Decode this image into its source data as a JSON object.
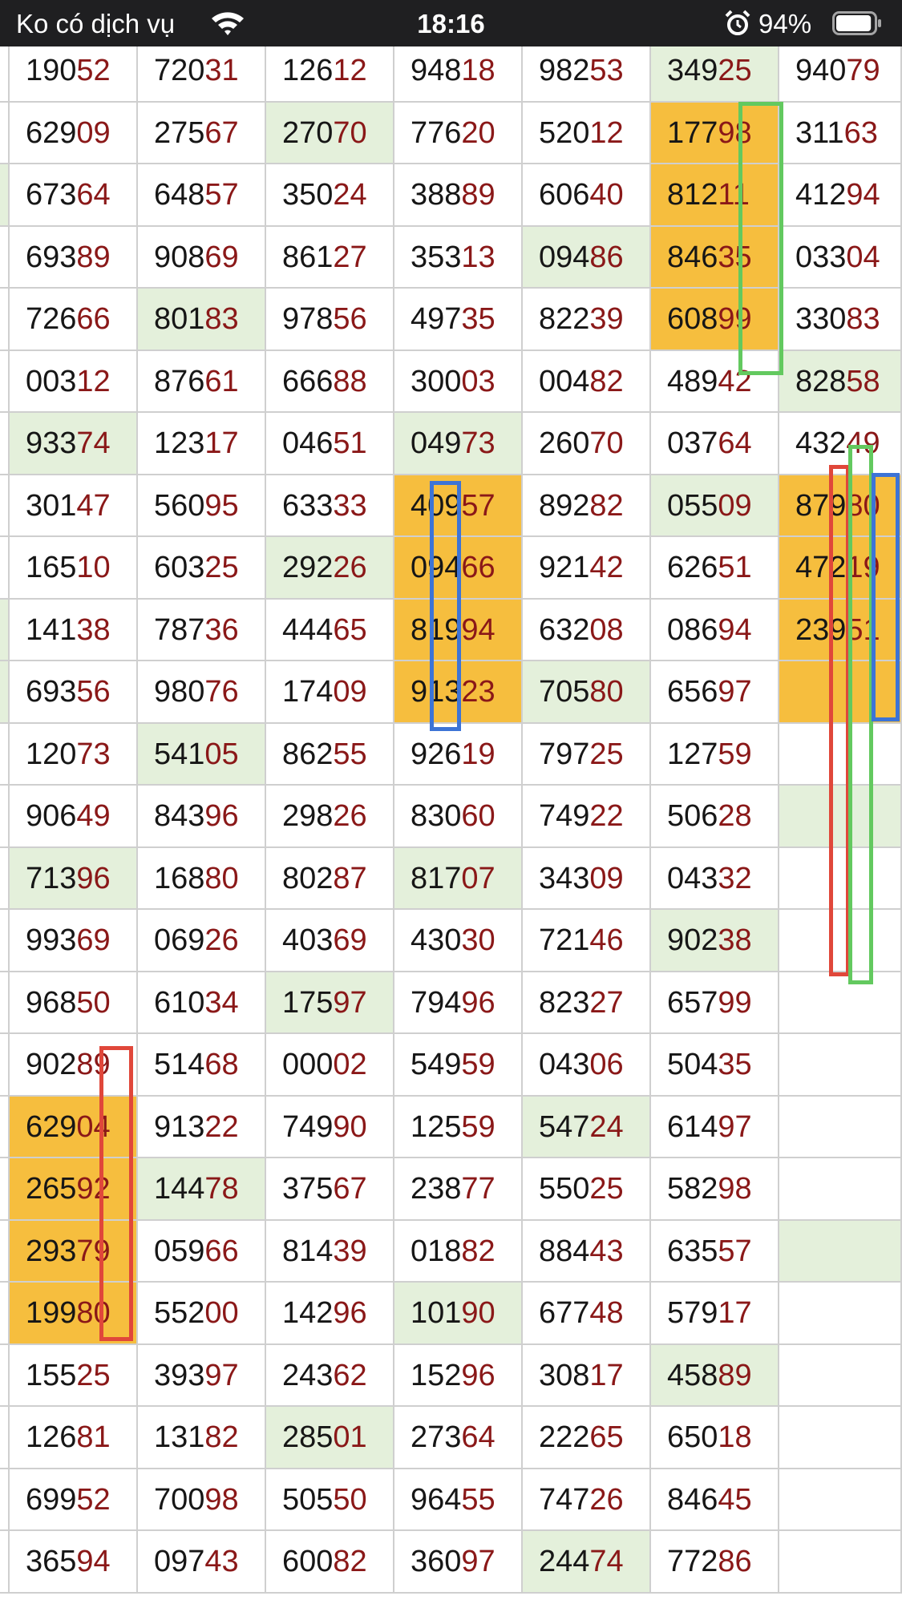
{
  "status_bar": {
    "carrier": "Ko có dịch vụ",
    "time": "18:16",
    "battery_percent": "94%",
    "battery_level": 0.94,
    "icons": [
      "wifi-icon",
      "alarm-icon",
      "battery-icon"
    ]
  },
  "colors": {
    "highlight_green": "#e4f0db",
    "highlight_orange": "#f6be3e",
    "tail_digits": "#8a1818",
    "marker_red": "#e0473a",
    "marker_green": "#63c95f",
    "marker_blue": "#3d74d6"
  },
  "table": {
    "rows": [
      [
        "19052",
        "72031",
        "12612",
        "94818",
        "98253",
        "34925",
        "94079"
      ],
      [
        "62909",
        "27567",
        "27070",
        "77620",
        "52012",
        "17798",
        "31163"
      ],
      [
        "67364",
        "64857",
        "35024",
        "38889",
        "60640",
        "81211",
        "41294"
      ],
      [
        "69389",
        "90869",
        "86127",
        "35313",
        "09486",
        "84635",
        "03304"
      ],
      [
        "72666",
        "80183",
        "97856",
        "49735",
        "82239",
        "60899",
        "33083"
      ],
      [
        "00312",
        "87661",
        "66688",
        "30003",
        "00482",
        "48942",
        "82858"
      ],
      [
        "93374",
        "12317",
        "04651",
        "04973",
        "26070",
        "03764",
        "43249"
      ],
      [
        "30147",
        "56095",
        "63333",
        "40957",
        "89282",
        "05509",
        "87980"
      ],
      [
        "16510",
        "60325",
        "29226",
        "09466",
        "92142",
        "62651",
        "47219"
      ],
      [
        "14138",
        "78736",
        "44465",
        "81994",
        "63208",
        "08694",
        "23951"
      ],
      [
        "69356",
        "98076",
        "17409",
        "91323",
        "70580",
        "65697",
        ""
      ],
      [
        "12073",
        "54105",
        "86255",
        "92619",
        "79725",
        "12759",
        ""
      ],
      [
        "90649",
        "84396",
        "29826",
        "83060",
        "74922",
        "50628",
        ""
      ],
      [
        "71396",
        "16880",
        "80287",
        "81707",
        "34309",
        "04332",
        ""
      ],
      [
        "99369",
        "06926",
        "40369",
        "43030",
        "72146",
        "90238",
        ""
      ],
      [
        "96850",
        "61034",
        "17597",
        "79496",
        "82327",
        "65799",
        ""
      ],
      [
        "90289",
        "51468",
        "00002",
        "54959",
        "04306",
        "50435",
        ""
      ],
      [
        "62904",
        "91322",
        "74990",
        "12559",
        "54724",
        "61497",
        ""
      ],
      [
        "26592",
        "14478",
        "37567",
        "23877",
        "55025",
        "58298",
        ""
      ],
      [
        "29379",
        "05966",
        "81439",
        "01882",
        "88443",
        "63557",
        ""
      ],
      [
        "19980",
        "55200",
        "14296",
        "10190",
        "67748",
        "57917",
        ""
      ],
      [
        "15525",
        "39397",
        "24362",
        "15296",
        "30817",
        "45889",
        ""
      ],
      [
        "12681",
        "13182",
        "28501",
        "27364",
        "22265",
        "65018",
        ""
      ],
      [
        "69952",
        "70098",
        "50550",
        "96455",
        "74726",
        "84645",
        ""
      ],
      [
        "36594",
        "09743",
        "60082",
        "36097",
        "24474",
        "77286",
        ""
      ]
    ],
    "highlights": [
      "r0c5:g",
      "r1c2:g",
      "r1c5:o",
      "r2c5:o",
      "r3c4:g",
      "r3c5:o",
      "r4c1:g",
      "r4c5:o",
      "r5c6:g",
      "r6c0:g",
      "r6c3:g",
      "r7c3:o",
      "r7c5:g",
      "r7c6:o",
      "r8c2:g",
      "r8c3:o",
      "r8c6:o",
      "r9c3:o",
      "r9c6:o",
      "r10c3:o",
      "r10c4:g",
      "r10c6:o",
      "r11c1:g",
      "r12c6:g",
      "r13c0:g",
      "r13c3:g",
      "r14c5:g",
      "r15c2:g",
      "r17c0:o",
      "r17c4:g",
      "r18c0:o",
      "r18c1:g",
      "r19c0:o",
      "r19c6:g",
      "r20c0:o",
      "r20c3:g",
      "r21c5:g",
      "r22c2:g",
      "r24c4:g"
    ]
  }
}
